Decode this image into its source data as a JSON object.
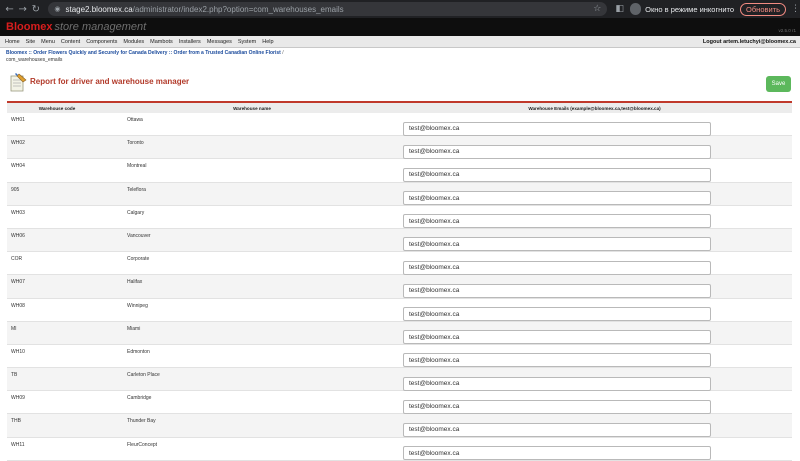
{
  "browser": {
    "url_host": "stage2.bloomex.ca",
    "url_path": "/administrator/index2.php?option=com_warehouses_emails",
    "incognito_label": "Окно в режиме инкогнито",
    "update_label": "Обновить"
  },
  "header": {
    "brand": "Bloomex",
    "subtitle": "store management",
    "version": "v2.5.0 r1"
  },
  "menu": {
    "items": [
      {
        "label": "Home"
      },
      {
        "label": "Site"
      },
      {
        "label": "Menu"
      },
      {
        "label": "Content"
      },
      {
        "label": "Components"
      },
      {
        "label": "Modules"
      },
      {
        "label": "Mambots"
      },
      {
        "label": "Installers"
      },
      {
        "label": "Messages"
      },
      {
        "label": "System"
      },
      {
        "label": "Help"
      }
    ],
    "logout": "Logout artem.letuchyi@bloomex.ca"
  },
  "breadcrumb": {
    "items": [
      "Bloomex :: Order Flowers Quickly and Securely for Canada Delivery :: Order from a Trusted Canadian Online Florist"
    ],
    "separator": "/",
    "current": "com_warehouses_emails"
  },
  "page": {
    "title": "Report for driver and warehouse manager",
    "save_label": "Save"
  },
  "table": {
    "columns": {
      "code": "Warehouse code",
      "name": "Warehouse name",
      "emails": "Warehouse Emails (example@bloomex.ca,test@bloomex.ca)"
    },
    "rows": [
      {
        "code": "WH01",
        "name": "Ottawa",
        "email": "test@bloomex.ca"
      },
      {
        "code": "WH02",
        "name": "Toronto",
        "email": "test@bloomex.ca"
      },
      {
        "code": "WH04",
        "name": "Montreal",
        "email": "test@bloomex.ca"
      },
      {
        "code": "905",
        "name": "Teleflora",
        "email": "test@bloomex.ca"
      },
      {
        "code": "WH03",
        "name": "Calgary",
        "email": "test@bloomex.ca"
      },
      {
        "code": "WH06",
        "name": "Vancouver",
        "email": "test@bloomex.ca"
      },
      {
        "code": "COR",
        "name": "Corporate",
        "email": "test@bloomex.ca"
      },
      {
        "code": "WH07",
        "name": "Halifax",
        "email": "test@bloomex.ca"
      },
      {
        "code": "WH08",
        "name": "Winnipeg",
        "email": "test@bloomex.ca"
      },
      {
        "code": "MI",
        "name": "Miami",
        "email": "test@bloomex.ca"
      },
      {
        "code": "WH10",
        "name": "Edmonton",
        "email": "test@bloomex.ca"
      },
      {
        "code": "TB",
        "name": "Carleton Place",
        "email": "test@bloomex.ca"
      },
      {
        "code": "WH09",
        "name": "Cambridge",
        "email": "test@bloomex.ca"
      },
      {
        "code": "THB",
        "name": "Thunder Bay",
        "email": "test@bloomex.ca"
      },
      {
        "code": "WH11",
        "name": "FleurConcept",
        "email": "test@bloomex.ca"
      }
    ]
  }
}
